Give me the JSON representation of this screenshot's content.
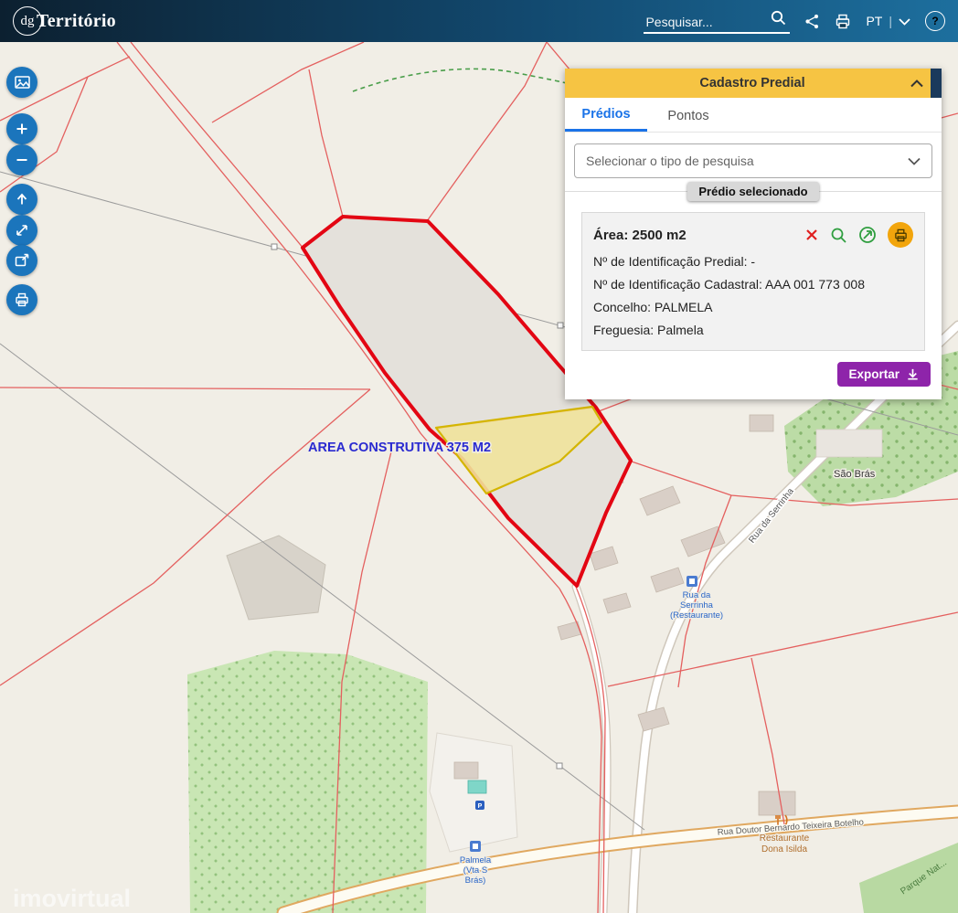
{
  "header": {
    "logo_circle": "dg",
    "logo_text": "Território",
    "search_placeholder": "Pesquisar...",
    "language": "PT"
  },
  "map_toolbar": {
    "buttons": [
      "basemap-gallery",
      "zoom-in",
      "zoom-out",
      "default-extent",
      "measure",
      "fullscreen",
      "print"
    ]
  },
  "panel": {
    "title": "Cadastro Predial",
    "tabs": {
      "predios": "Prédios",
      "pontos": "Pontos"
    },
    "search_type_placeholder": "Selecionar o tipo de pesquisa",
    "selected_label": "Prédio selecionado",
    "property": {
      "area": "Área: 2500 m2",
      "id_predial": "Nº de Identificação Predial: -",
      "id_cadastral": "Nº de Identificação Cadastral: AAA 001 773 008",
      "concelho": "Concelho: PALMELA",
      "freguesia": "Freguesia: Palmela"
    },
    "export_label": "Exportar"
  },
  "map": {
    "area_label": "AREA CONSTRUTIVA 375 M2",
    "labels": {
      "sao_bras": "São Brás",
      "rua_da_serrinha": "Rua da Serrinha",
      "stop_line1": "Rua da",
      "stop_line2": "Serrinha",
      "stop_line3": "(Restaurante)",
      "palmela_line1": "Palmela",
      "palmela_line2": "(Vta S",
      "palmela_line3": "Brás)",
      "restaurant_line1": "Restaurante",
      "restaurant_line2": "Dona Isilda",
      "road_bottom": "Rua Doutor Bernardo Teixeira Botelho",
      "park": "Parque Nat...",
      "watermark": "imovirtual"
    }
  },
  "colors": {
    "panel_header": "#F6C443",
    "accent_blue": "#1A73E8",
    "parcel_outline": "#E30613",
    "highlight_parcel": "#E8D44D",
    "export_button": "#8E24AA",
    "toolbar_button": "#1B75BC"
  }
}
